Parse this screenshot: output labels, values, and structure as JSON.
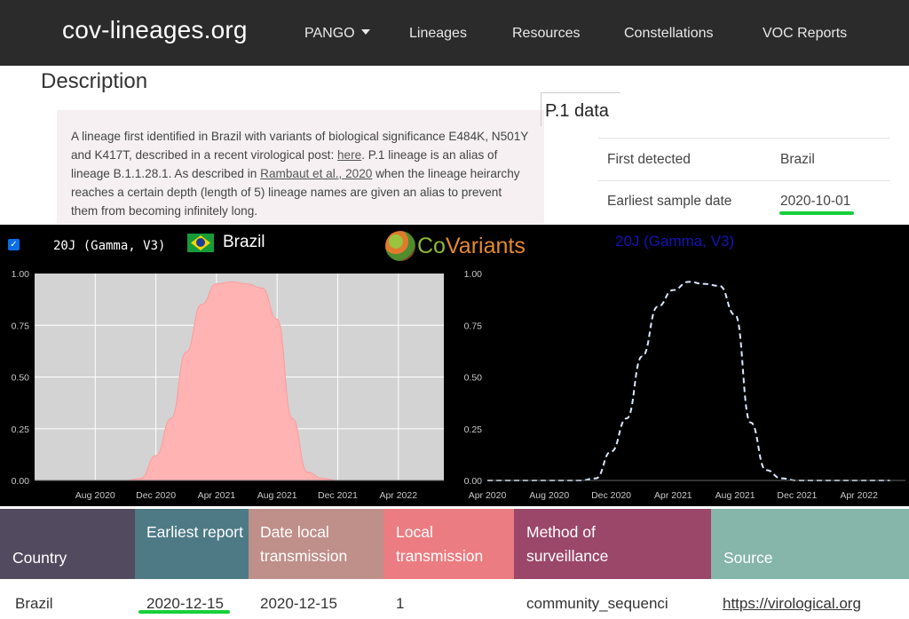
{
  "nav": {
    "brand": "cov-lineages.org",
    "items": [
      "PANGO",
      "Lineages",
      "Resources",
      "Constellations",
      "VOC Reports"
    ]
  },
  "description": {
    "heading": "Description",
    "text_parts": [
      "A lineage first identified in Brazil with variants of biological significance E484K, N501Y and K417T, described in a recent virological post: ",
      "here",
      ". P.1 lineage is an alias of lineage B.1.1.28.1. As described in ",
      "Rambaut et al., 2020",
      " when the lineage heirarchy reaches a certain depth (length of 5) lineage names are given an alias to prevent them from becoming infinitely long."
    ]
  },
  "p1_data": {
    "title": "P.1 data",
    "rows": [
      {
        "key": "First detected",
        "value": "Brazil"
      },
      {
        "key": "Earliest sample date",
        "value": "2020-10-01"
      }
    ]
  },
  "covariants": {
    "variant": "20J (Gamma, V3)",
    "country": "Brazil",
    "logo_a": "Co",
    "logo_b": "Variants",
    "right_title": "20J (Gamma, V3)",
    "checkbox_checked": true,
    "colors": {
      "fill": "#ffb3b3",
      "fill_stroke": "#ff9a9a",
      "left_bg": "#d3d3d3",
      "dashed": "#d8e8ff",
      "title_blue": "#1414b8"
    }
  },
  "chart_data": [
    {
      "type": "area",
      "title": "",
      "x": [
        "2020-04",
        "2020-08",
        "2020-10",
        "2020-11",
        "2020-12",
        "2021-01",
        "2021-02",
        "2021-03",
        "2021-04",
        "2021-05",
        "2021-06",
        "2021-07",
        "2021-08",
        "2021-09",
        "2021-10",
        "2021-11",
        "2021-12",
        "2022-04",
        "2022-06"
      ],
      "series": [
        {
          "values": [
            0,
            0,
            0,
            0.01,
            0.12,
            0.3,
            0.62,
            0.85,
            0.95,
            0.96,
            0.95,
            0.93,
            0.78,
            0.3,
            0.04,
            0.01,
            0,
            0,
            0
          ]
        }
      ],
      "xticks": [
        "Aug 2020",
        "Dec 2020",
        "Apr 2021",
        "Aug 2021",
        "Dec 2021",
        "Apr 2022"
      ],
      "yticks": [
        "0.00",
        "0.25",
        "0.50",
        "0.75",
        "1.00"
      ],
      "ylim": [
        0,
        1
      ],
      "grid": true
    },
    {
      "type": "line",
      "title": "20J (Gamma, V3)",
      "x": [
        "2020-04",
        "2020-08",
        "2020-10",
        "2020-11",
        "2020-12",
        "2021-01",
        "2021-02",
        "2021-03",
        "2021-04",
        "2021-05",
        "2021-06",
        "2021-07",
        "2021-08",
        "2021-09",
        "2021-10",
        "2021-11",
        "2021-12",
        "2022-04",
        "2022-06"
      ],
      "series": [
        {
          "values": [
            0,
            0,
            0,
            0.01,
            0.14,
            0.3,
            0.6,
            0.84,
            0.92,
            0.96,
            0.95,
            0.94,
            0.8,
            0.28,
            0.05,
            0.01,
            0,
            0,
            0
          ]
        }
      ],
      "xticks": [
        "Apr 2020",
        "Aug 2020",
        "Dec 2020",
        "Apr 2021",
        "Aug 2021",
        "Dec 2021",
        "Apr 2022"
      ],
      "yticks": [
        "0.00",
        "0.25",
        "0.50",
        "0.75",
        "1.00"
      ],
      "ylim": [
        0,
        1
      ],
      "grid": false
    }
  ],
  "table": {
    "headers": [
      {
        "label": "Country",
        "color": "#524a5e"
      },
      {
        "label": "Earliest report",
        "color": "#4e7a86"
      },
      {
        "label": "Date local transmission",
        "color": "#bf8f8a"
      },
      {
        "label": "Local transmission",
        "color": "#eb7c81"
      },
      {
        "label": "Method of surveillance",
        "color": "#9a4769"
      },
      {
        "label": "Source",
        "color": "#86b5a9"
      }
    ],
    "row": [
      "Brazil",
      "2020-12-15",
      "2020-12-15",
      "1",
      "community_sequenci",
      "https://virological.org"
    ]
  }
}
